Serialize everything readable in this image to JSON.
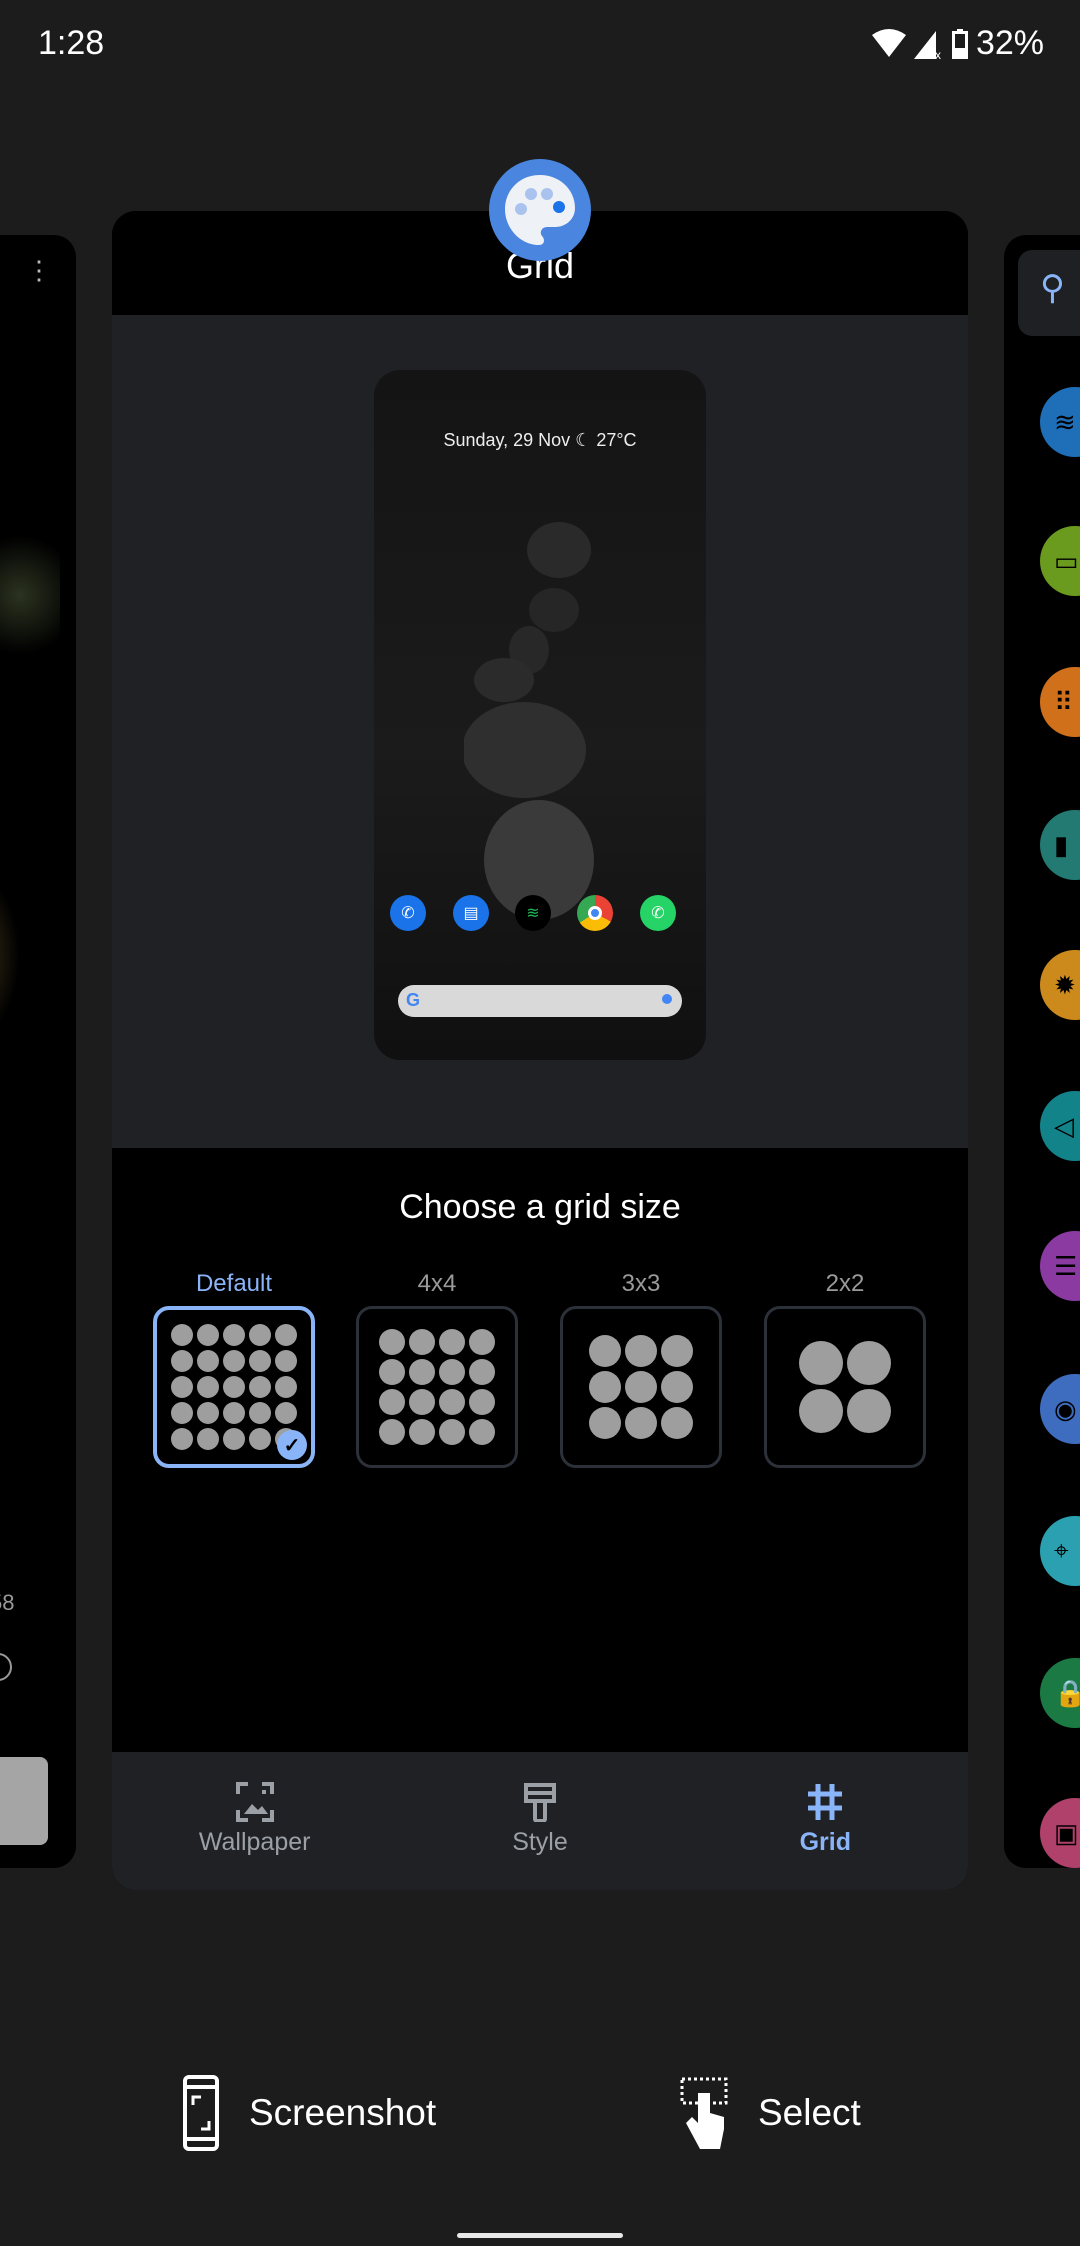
{
  "status_bar": {
    "time": "1:28",
    "battery": "32%",
    "icons": [
      "wifi-icon",
      "signal-no-data-icon",
      "battery-icon"
    ]
  },
  "app": {
    "title": "Grid",
    "icon": "palette-icon",
    "accent": "#8ab4f8"
  },
  "preview": {
    "date_weather": "Sunday, 29 Nov ☾ 27°C",
    "dock": [
      "phone",
      "messages",
      "spotify",
      "chrome",
      "whatsapp"
    ]
  },
  "grid_picker": {
    "title": "Choose a grid size",
    "options": [
      {
        "label": "Default",
        "cols": 5,
        "selected": true
      },
      {
        "label": "4x4",
        "cols": 4,
        "selected": false
      },
      {
        "label": "3x3",
        "cols": 3,
        "selected": false
      },
      {
        "label": "2x2",
        "cols": 2,
        "selected": false
      }
    ]
  },
  "bottom_nav": [
    {
      "label": "Wallpaper",
      "active": false
    },
    {
      "label": "Style",
      "active": false
    },
    {
      "label": "Grid",
      "active": true
    }
  ],
  "left_card": {
    "partial_text": "58"
  },
  "right_card": {
    "qs_colors": [
      "#1e6fb8",
      "#6a9a1e",
      "#d0701a",
      "#237a73",
      "#cc8a1c",
      "#13838a",
      "#8a3aa0",
      "#3e6cbf",
      "#2aa0b0",
      "#1b7a44",
      "#b0416a"
    ]
  },
  "actions": {
    "screenshot": "Screenshot",
    "select": "Select"
  }
}
